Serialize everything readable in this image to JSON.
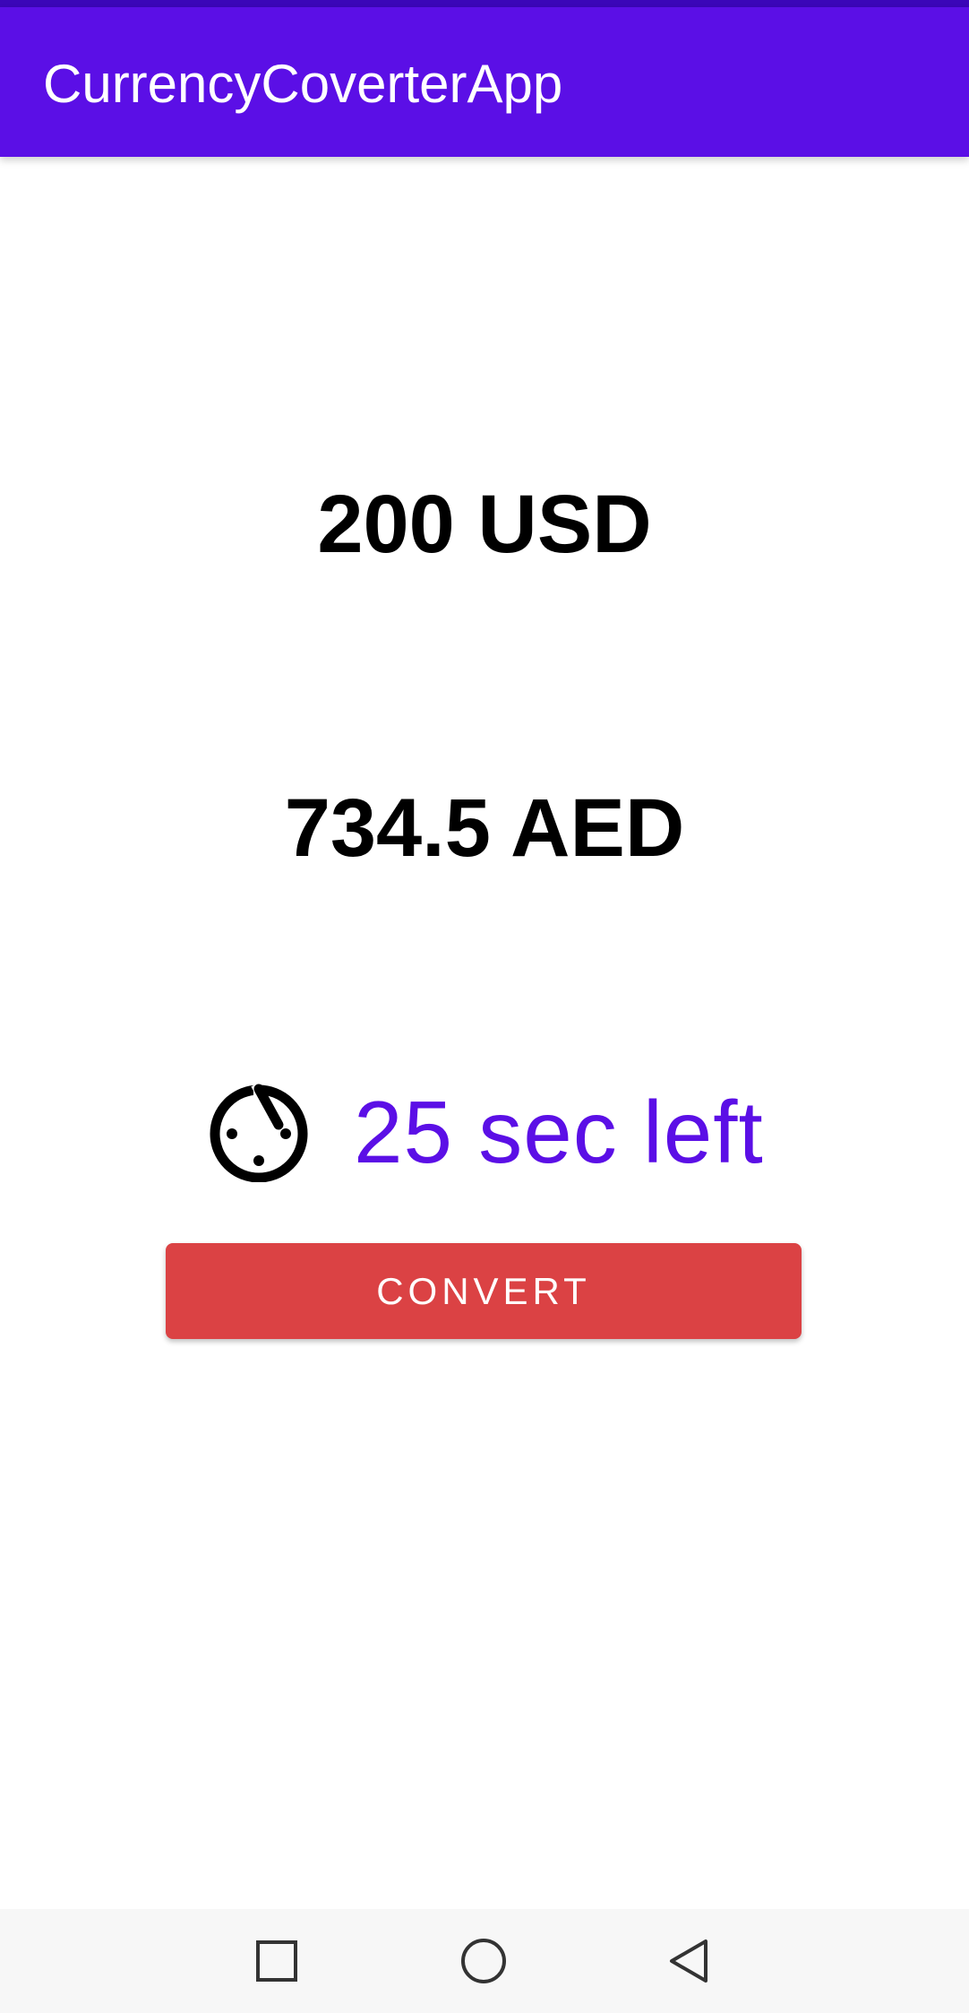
{
  "app_bar": {
    "title": "CurrencyCoverterApp",
    "color": "#5b0fe6"
  },
  "conversion": {
    "source_amount": "200 USD",
    "converted_amount": "734.5 AED"
  },
  "timer": {
    "icon": "timer-icon",
    "text": "25 sec left",
    "color": "#5b0fe6"
  },
  "convert_button": {
    "label": "CONVERT",
    "color": "#db4244"
  },
  "navigation": {
    "buttons": [
      {
        "icon": "square-recents-icon"
      },
      {
        "icon": "circle-home-icon"
      },
      {
        "icon": "triangle-back-icon"
      }
    ]
  }
}
